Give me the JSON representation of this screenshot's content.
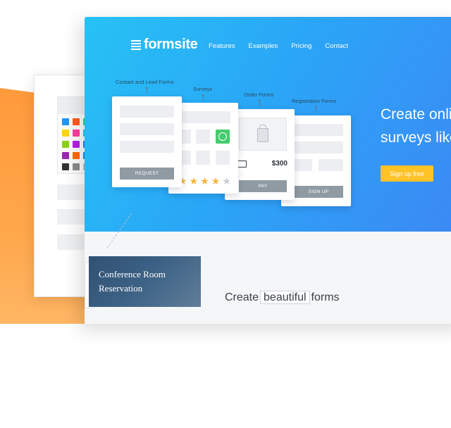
{
  "brand": {
    "name": "formsite"
  },
  "nav": [
    "Features",
    "Examples",
    "Pricing",
    "Contact"
  ],
  "hero": {
    "title_line1": "Create onli",
    "title_line2": "surveys like",
    "cta_label": "Sign up free",
    "cta_color": "#ffc328",
    "gradient": [
      "#27c2f5",
      "#3d88f5"
    ]
  },
  "form_types": {
    "contact": {
      "label": "Contact and Lead Forms",
      "button": "REQUEST"
    },
    "surveys": {
      "label": "Surveys",
      "rating": 4,
      "max": 5
    },
    "order": {
      "label": "Order Forms",
      "price": "$300",
      "button": "PAY"
    },
    "registration": {
      "label": "Registration Forms",
      "button": "SIGN UP"
    }
  },
  "template_card": {
    "line1": "Conference Room",
    "line2": "Reservation"
  },
  "tagline": {
    "pre": "Create",
    "boxed": "beautiful",
    "post": "forms"
  },
  "palette_colors": [
    "#2196f3",
    "#ff5a1f",
    "#2ed573",
    "#ffd21f",
    "#ff3da0",
    "#29c4d9",
    "#8bd11a",
    "#b31fe3",
    "#2b7de9",
    "#9c27b0",
    "#ff6a00",
    "#1e88e5",
    "#333333",
    "#8a8a8a",
    "#bdbdbd"
  ]
}
